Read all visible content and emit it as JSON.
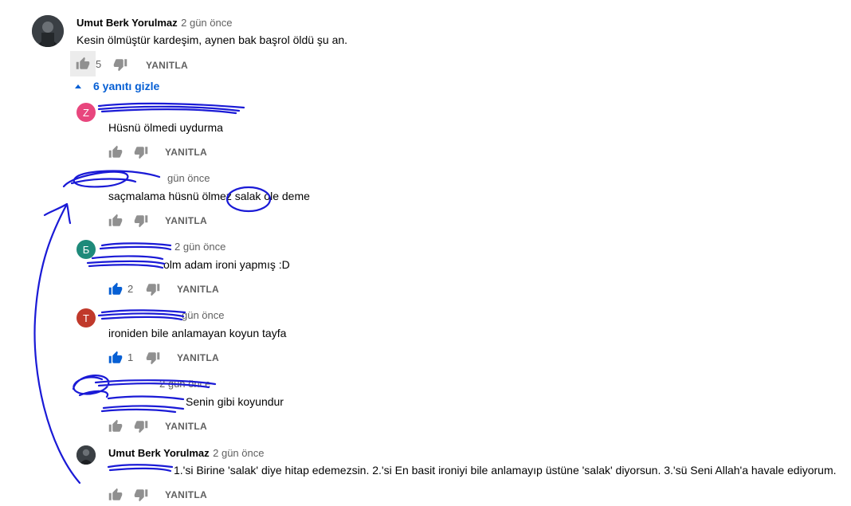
{
  "top_comment": {
    "author": "Umut Berk Yorulmaz",
    "time": "2 gün önce",
    "text": "Kesin ölmüştür kardeşim, aynen bak başrol öldü şu an.",
    "likes": "5",
    "reply_label": "YANITLA"
  },
  "replies_toggle": "6 yanıtı gizle",
  "replies": [
    {
      "initial": "Z",
      "avatar_color": "#e8467d",
      "time": "",
      "text": "Hüsnü ölmedi uydurma",
      "likes": "",
      "reply_label": "YANITLA"
    },
    {
      "initial": "",
      "avatar_color": "#ffffff",
      "time": "gün önce",
      "text": "saçmalama hüsnü ölmez salak ole deme",
      "likes": "",
      "reply_label": "YANITLA"
    },
    {
      "initial": "Б",
      "avatar_color": "#1e8a7a",
      "time": "2 gün önce",
      "text": "olm adam ironi yapmış :D",
      "likes": "2",
      "reply_label": "YANITLA"
    },
    {
      "initial": "T",
      "avatar_color": "#c0392b",
      "time": "gün önce",
      "text": "ironiden bile anlamayan koyun tayfa",
      "likes": "1",
      "reply_label": "YANITLA"
    },
    {
      "initial": "",
      "avatar_color": "#ffffff",
      "time": "2 gün önce",
      "text": "Senin gibi koyundur",
      "likes": "",
      "reply_label": "YANITLA"
    },
    {
      "author": "Umut Berk Yorulmaz",
      "time": "2 gün önce",
      "text": "1.'si Birine 'salak' diye hitap edemezsin. 2.'si En basit ironiyi bile anlamayıp üstüne 'salak' diyorsun. 3.'sü Seni Allah'a havale ediyorum.",
      "likes": "",
      "reply_label": "YANITLA"
    }
  ],
  "colors": {
    "link_blue": "#065fd4",
    "secondary_text": "#606060",
    "scribble_ink": "#1a1ad6"
  },
  "icons": [
    "thumb-up-icon",
    "thumb-down-icon",
    "caret-up-icon"
  ]
}
